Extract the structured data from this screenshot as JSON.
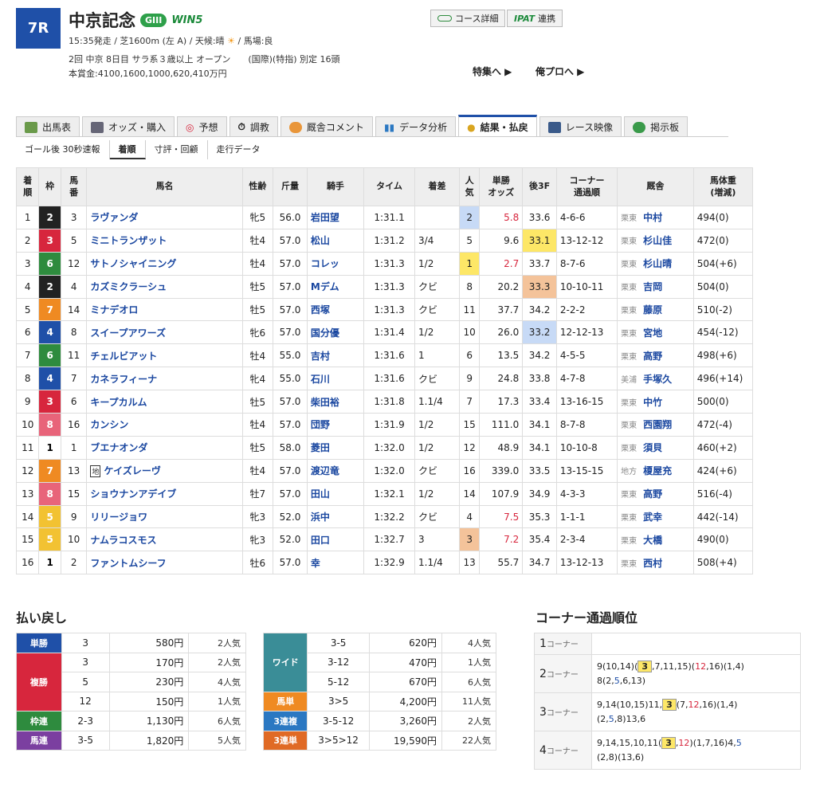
{
  "race": {
    "number": "7R",
    "name": "中京記念",
    "grade": "GIII",
    "win5": "WIN5",
    "line1_pre": "15:35発走 / 芝1600m (左 A) / 天候:晴",
    "line1_post": "/ 馬場:良",
    "line2": "2回 中京 8日目 サラ系３歳以上 オープン　　(国際)(特指) 別定 16頭",
    "line3": "本賞金:4100,1600,1000,620,410万円"
  },
  "header": {
    "course_btn": "コース詳細",
    "ipat_logo": "IPAT",
    "ipat_btn": "連携",
    "tokushu": "特集へ ▶",
    "orepro": "俺プロへ ▶"
  },
  "tabs": [
    {
      "label": "出馬表"
    },
    {
      "label": "オッズ・購入"
    },
    {
      "label": "予想"
    },
    {
      "label": "調教"
    },
    {
      "label": "厩舎コメント"
    },
    {
      "label": "データ分析"
    },
    {
      "label": "結果・払戻"
    },
    {
      "label": "レース映像"
    },
    {
      "label": "掲示板"
    }
  ],
  "subtabs": [
    "ゴール後 30秒速報",
    "着順",
    "寸評・回顧",
    "走行データ"
  ],
  "columns": [
    "着\n順",
    "枠",
    "馬\n番",
    "馬名",
    "性齢",
    "斤量",
    "騎手",
    "タイム",
    "着差",
    "人\n気",
    "単勝\nオッズ",
    "後3F",
    "コーナー\n通過順",
    "厩舎",
    "馬体重\n(増減)"
  ],
  "results": [
    {
      "rank": "1",
      "waku": "2",
      "num": "3",
      "horse": "ラヴァンダ",
      "sex": "牝5",
      "weight": "56.0",
      "jockey": "岩田望",
      "time": "1:31.1",
      "margin": "",
      "pop": "2",
      "odds": "5.8",
      "last3f": "33.6",
      "corner": "4-6-6",
      "area": "栗東",
      "trainer": "中村",
      "bw": "494(0)"
    },
    {
      "rank": "2",
      "waku": "3",
      "num": "5",
      "horse": "ミニトランザット",
      "sex": "牡4",
      "weight": "57.0",
      "jockey": "松山",
      "time": "1:31.2",
      "margin": "3/4",
      "pop": "5",
      "odds": "9.6",
      "last3f": "33.1",
      "corner": "13-12-12",
      "area": "栗東",
      "trainer": "杉山佳",
      "bw": "472(0)"
    },
    {
      "rank": "3",
      "waku": "6",
      "num": "12",
      "horse": "サトノシャイニング",
      "sex": "牡4",
      "weight": "57.0",
      "jockey": "コレッ",
      "time": "1:31.3",
      "margin": "1/2",
      "pop": "1",
      "odds": "2.7",
      "last3f": "33.7",
      "corner": "8-7-6",
      "area": "栗東",
      "trainer": "杉山晴",
      "bw": "504(+6)"
    },
    {
      "rank": "4",
      "waku": "2",
      "num": "4",
      "horse": "カズミクラーシュ",
      "sex": "牡5",
      "weight": "57.0",
      "jockey": "Mデム",
      "time": "1:31.3",
      "margin": "クビ",
      "pop": "8",
      "odds": "20.2",
      "last3f": "33.3",
      "corner": "10-10-11",
      "area": "栗東",
      "trainer": "吉岡",
      "bw": "504(0)"
    },
    {
      "rank": "5",
      "waku": "7",
      "num": "14",
      "horse": "ミナデオロ",
      "sex": "牡5",
      "weight": "57.0",
      "jockey": "西塚",
      "time": "1:31.3",
      "margin": "クビ",
      "pop": "11",
      "odds": "37.7",
      "last3f": "34.2",
      "corner": "2-2-2",
      "area": "栗東",
      "trainer": "藤原",
      "bw": "510(-2)"
    },
    {
      "rank": "6",
      "waku": "4",
      "num": "8",
      "horse": "スイープアワーズ",
      "sex": "牝6",
      "weight": "57.0",
      "jockey": "国分優",
      "time": "1:31.4",
      "margin": "1/2",
      "pop": "10",
      "odds": "26.0",
      "last3f": "33.2",
      "corner": "12-12-13",
      "area": "栗東",
      "trainer": "宮地",
      "bw": "454(-12)"
    },
    {
      "rank": "7",
      "waku": "6",
      "num": "11",
      "horse": "チェルビアット",
      "sex": "牡4",
      "weight": "55.0",
      "jockey": "吉村",
      "time": "1:31.6",
      "margin": "1",
      "pop": "6",
      "odds": "13.5",
      "last3f": "34.2",
      "corner": "4-5-5",
      "area": "栗東",
      "trainer": "高野",
      "bw": "498(+6)"
    },
    {
      "rank": "8",
      "waku": "4",
      "num": "7",
      "horse": "カネラフィーナ",
      "sex": "牝4",
      "weight": "55.0",
      "jockey": "石川",
      "time": "1:31.6",
      "margin": "クビ",
      "pop": "9",
      "odds": "24.8",
      "last3f": "33.8",
      "corner": "4-7-8",
      "area": "美浦",
      "trainer": "手塚久",
      "bw": "496(+14)"
    },
    {
      "rank": "9",
      "waku": "3",
      "num": "6",
      "horse": "キープカルム",
      "sex": "牡5",
      "weight": "57.0",
      "jockey": "柴田裕",
      "time": "1:31.8",
      "margin": "1.1/4",
      "pop": "7",
      "odds": "17.3",
      "last3f": "33.4",
      "corner": "13-16-15",
      "area": "栗東",
      "trainer": "中竹",
      "bw": "500(0)"
    },
    {
      "rank": "10",
      "waku": "8",
      "num": "16",
      "horse": "カンシン",
      "sex": "牡4",
      "weight": "57.0",
      "jockey": "団野",
      "time": "1:31.9",
      "margin": "1/2",
      "pop": "15",
      "odds": "111.0",
      "last3f": "34.1",
      "corner": "8-7-8",
      "area": "栗東",
      "trainer": "西園翔",
      "bw": "472(-4)"
    },
    {
      "rank": "11",
      "waku": "1",
      "num": "1",
      "horse": "ブエナオンダ",
      "sex": "牡5",
      "weight": "58.0",
      "jockey": "菱田",
      "time": "1:32.0",
      "margin": "1/2",
      "pop": "12",
      "odds": "48.9",
      "last3f": "34.1",
      "corner": "10-10-8",
      "area": "栗東",
      "trainer": "須貝",
      "bw": "460(+2)"
    },
    {
      "rank": "12",
      "waku": "7",
      "num": "13",
      "horse": "ケイズレーヴ",
      "chihou": "地",
      "sex": "牡4",
      "weight": "57.0",
      "jockey": "渡辺竜",
      "time": "1:32.0",
      "margin": "クビ",
      "pop": "16",
      "odds": "339.0",
      "last3f": "33.5",
      "corner": "13-15-15",
      "area": "地方",
      "trainer": "榎屋充",
      "bw": "424(+6)"
    },
    {
      "rank": "13",
      "waku": "8",
      "num": "15",
      "horse": "ショウナンアデイブ",
      "sex": "牡7",
      "weight": "57.0",
      "jockey": "田山",
      "time": "1:32.1",
      "margin": "1/2",
      "pop": "14",
      "odds": "107.9",
      "last3f": "34.9",
      "corner": "4-3-3",
      "area": "栗東",
      "trainer": "高野",
      "bw": "516(-4)"
    },
    {
      "rank": "14",
      "waku": "5",
      "num": "9",
      "horse": "リリージョワ",
      "sex": "牝3",
      "weight": "52.0",
      "jockey": "浜中",
      "time": "1:32.2",
      "margin": "クビ",
      "pop": "4",
      "odds": "7.5",
      "last3f": "35.3",
      "corner": "1-1-1",
      "area": "栗東",
      "trainer": "武幸",
      "bw": "442(-14)"
    },
    {
      "rank": "15",
      "waku": "5",
      "num": "10",
      "horse": "ナムラコスモス",
      "sex": "牝3",
      "weight": "52.0",
      "jockey": "田口",
      "time": "1:32.7",
      "margin": "3",
      "pop": "3",
      "odds": "7.2",
      "last3f": "35.4",
      "corner": "2-3-4",
      "area": "栗東",
      "trainer": "大橋",
      "bw": "490(0)"
    },
    {
      "rank": "16",
      "waku": "1",
      "num": "2",
      "horse": "ファントムシーフ",
      "sex": "牡6",
      "weight": "57.0",
      "jockey": "幸",
      "time": "1:32.9",
      "margin": "1.1/4",
      "pop": "13",
      "odds": "55.7",
      "last3f": "34.7",
      "corner": "13-12-13",
      "area": "栗東",
      "trainer": "西村",
      "bw": "508(+4)"
    }
  ],
  "payout": {
    "title": "払い戻し",
    "tansho": {
      "label": "単勝",
      "rows": [
        {
          "combo": "3",
          "yen": "580円",
          "pop": "2人気"
        }
      ]
    },
    "fukusho": {
      "label": "複勝",
      "rows": [
        {
          "combo": "3",
          "yen": "170円",
          "pop": "2人気"
        },
        {
          "combo": "5",
          "yen": "230円",
          "pop": "4人気"
        },
        {
          "combo": "12",
          "yen": "150円",
          "pop": "1人気"
        }
      ]
    },
    "wakuren": {
      "label": "枠連",
      "rows": [
        {
          "combo": "2-3",
          "yen": "1,130円",
          "pop": "6人気"
        }
      ]
    },
    "umaren": {
      "label": "馬連",
      "rows": [
        {
          "combo": "3-5",
          "yen": "1,820円",
          "pop": "5人気"
        }
      ]
    },
    "wide": {
      "label": "ワイド",
      "rows": [
        {
          "combo": "3-5",
          "yen": "620円",
          "pop": "4人気"
        },
        {
          "combo": "3-12",
          "yen": "470円",
          "pop": "1人気"
        },
        {
          "combo": "5-12",
          "yen": "670円",
          "pop": "6人気"
        }
      ]
    },
    "umatan": {
      "label": "馬単",
      "rows": [
        {
          "combo": "3>5",
          "yen": "4,200円",
          "pop": "11人気"
        }
      ]
    },
    "sanrenpuku": {
      "label": "3連複",
      "rows": [
        {
          "combo": "3-5-12",
          "yen": "3,260円",
          "pop": "2人気"
        }
      ]
    },
    "sanrentan": {
      "label": "3連単",
      "rows": [
        {
          "combo": "3>5>12",
          "yen": "19,590円",
          "pop": "22人気"
        }
      ]
    }
  },
  "corner": {
    "title": "コーナー通過順位",
    "unit": "コーナー",
    "c1": {
      "num": "1",
      "text": ""
    },
    "c2": {
      "num": "2",
      "a": "9(10,14)(",
      "hl": "3",
      "b": ",7,11,15)(",
      "red": "12",
      "c": ",16)(1,4)",
      "line2a": "8(2,",
      "blue": "5",
      "line2b": ",6,13)"
    },
    "c3": {
      "num": "3",
      "a": "9,14(10,15)11,",
      "hl": "3",
      "b": "(7,",
      "red": "12",
      "c": ",16)(1,4)",
      "line2a": "(2,",
      "blue": "5",
      "line2b": ",8)13,6"
    },
    "c4": {
      "num": "4",
      "a": "9,14,15,10,11(",
      "hl": "3",
      "b": ",",
      "red": "12",
      "c": ")(1,7,16)4,",
      "blue": "5",
      "line2": "(2,8)(13,6)"
    }
  },
  "colors": {
    "accent": "#1f50a8",
    "waku2": "#222222",
    "waku3": "#d7263d",
    "waku4": "#1f50a8",
    "waku5": "#f2c232",
    "waku6": "#2e8b3e",
    "waku7": "#ef8a22",
    "waku8": "#e8647a"
  }
}
